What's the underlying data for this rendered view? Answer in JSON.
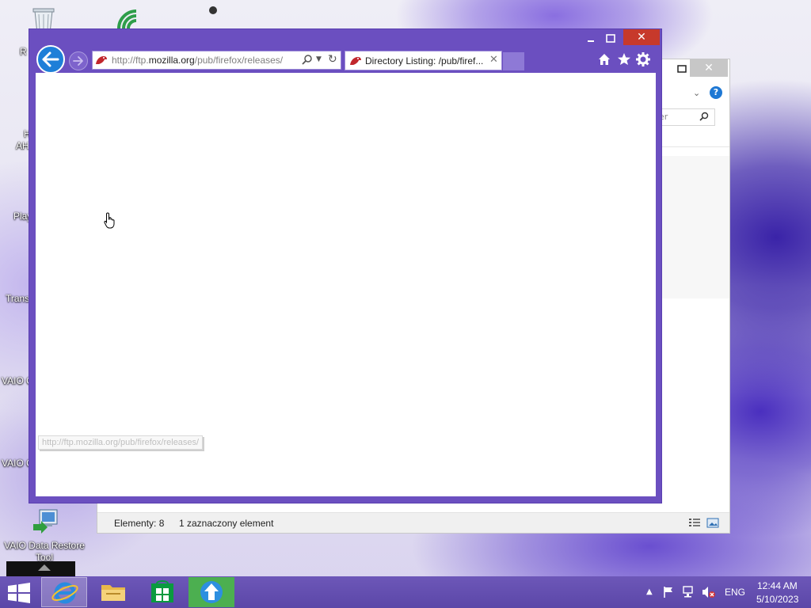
{
  "desktop": {
    "icons": [
      {
        "label": "VAIO Data Restore Tool",
        "name": "vaio-data-restore-tool"
      }
    ],
    "partial_labels": {
      "recycle": "R",
      "h": "H",
      "ahd": "AH",
      "play": "Play",
      "trans": "Trans",
      "vaio1": "VAIO C",
      "vaio2": "VAIO C"
    }
  },
  "explorer_window": {
    "search_placeholder": "er",
    "help_label": "?",
    "status_items": "Elementy: 8",
    "status_selected": "1 zaznaczony element"
  },
  "ie_window": {
    "address": {
      "prefix": "http://ftp.",
      "domain": "mozilla.org",
      "path": "/pub/firefox/releases/"
    },
    "tab_label": "Directory Listing: /pub/firef...",
    "status_url": "http://ftp.mozilla.org/pub/firefox/releases/",
    "icons": {
      "back": "back-arrow-icon",
      "forward": "forward-arrow-icon",
      "home": "home-icon",
      "favorites": "star-icon",
      "tools": "gear-icon"
    }
  },
  "taskbar": {
    "language": "ENG",
    "time": "12:44 AM",
    "date": "5/10/2023"
  },
  "colors": {
    "ie_frame": "#6b4fc0",
    "close_red": "#c7392b",
    "taskbar": "#5b47a8",
    "ie_blue": "#1e7fd8"
  }
}
